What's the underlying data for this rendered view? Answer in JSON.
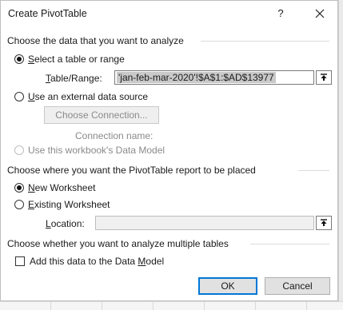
{
  "dialog": {
    "title": "Create PivotTable",
    "help_label": "?",
    "close_icon": "close-icon"
  },
  "source_section": {
    "heading": "Choose the data that you want to analyze",
    "select_range_label": "elect a table or range",
    "select_range_accel": "S",
    "table_range_label_accel": "T",
    "table_range_label_rest": "able/Range:",
    "table_range_value": "'jan-feb-mar-2020'!$A$1:$AD$13977",
    "external_source_label_accel": "U",
    "external_source_label_rest": "se an external data source",
    "choose_connection_label": "Choose Connection...",
    "connection_name_label": "Connection name:",
    "data_model_source_label": "Use this workbook's Data Model"
  },
  "placement_section": {
    "heading": "Choose where you want the PivotTable report to be placed",
    "new_worksheet_accel": "N",
    "new_worksheet_rest": "ew Worksheet",
    "existing_worksheet_accel": "E",
    "existing_worksheet_rest": "xisting Worksheet",
    "location_accel": "L",
    "location_rest": "ocation:",
    "location_value": ""
  },
  "multiple_tables_section": {
    "heading": "Choose whether you want to analyze multiple tables",
    "add_to_model_label_start": "Add this data to the Data ",
    "add_to_model_accel": "M",
    "add_to_model_label_end": "odel"
  },
  "buttons": {
    "ok": "OK",
    "cancel": "Cancel"
  },
  "colors": {
    "accent": "#0078d7",
    "selection": "#c9c9c9"
  }
}
